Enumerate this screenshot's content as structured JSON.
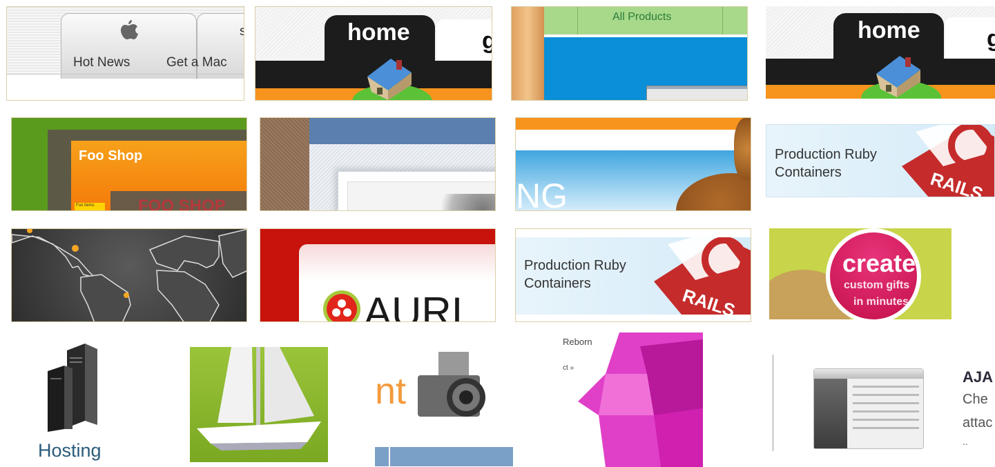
{
  "tiles": {
    "apple": {
      "tab1": "Hot News",
      "tab2": "Get a Mac",
      "tab3_partial": "s"
    },
    "home1": {
      "label": "home",
      "partial": "g"
    },
    "products": {
      "label": "All Products"
    },
    "home2": {
      "label": "home",
      "partial": "g"
    },
    "foo_shop": {
      "title": "Foo Shop",
      "badge": "Foo Items",
      "ghost": "FOO SHOP"
    },
    "rails1": {
      "line1": "Production Ruby",
      "line2": "Containers",
      "ribbon": "RAILS"
    },
    "ng": {
      "text": "NG"
    },
    "aura": {
      "text": "AURI"
    },
    "rails2": {
      "line1": "Production Ruby",
      "line2": "Containers",
      "ribbon": "RAILS"
    },
    "create": {
      "line1": "create",
      "line2": "custom gifts",
      "line3": "in minutes"
    },
    "hosting": {
      "label": "Hosting"
    },
    "camera": {
      "text": "nt"
    },
    "reborn": {
      "line1": "Reborn",
      "line2": "ct »"
    },
    "ajax": {
      "title": "AJA",
      "line1": "Che",
      "line2": "attac",
      "line3": ".."
    }
  },
  "colors": {
    "tile_border": "#d9cfa8",
    "home_black": "#1c1c1c",
    "home_orange": "#f7941d",
    "home_green": "#5bc238",
    "products_green": "#a8d98a",
    "products_blue": "#0a8fd8",
    "foo_green": "#5a9b1e",
    "foo_orange": "#f58a0a",
    "rails_red": "#c52b2b",
    "aura_red": "#c8120c",
    "create_lime": "#c8d44a",
    "create_pink": "#d4145a",
    "magenta": "#d020b0"
  },
  "icons": [
    "apple-logo-icon",
    "house-icon",
    "rails-ribbon-icon",
    "aura-hex-logo-icon",
    "server-tower-icon",
    "sailboat-icon",
    "camera-icon",
    "magenta-cross-icon",
    "app-window-icon"
  ]
}
